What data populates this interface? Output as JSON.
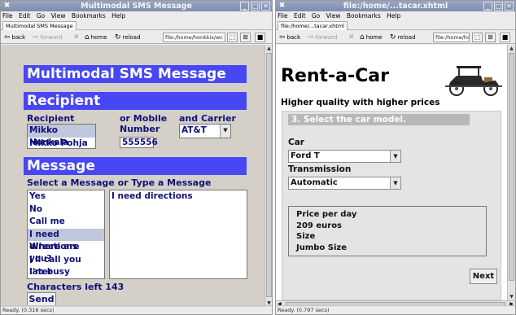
{
  "windows": [
    {
      "title": "Multimodal SMS Message",
      "menu": [
        "File",
        "Edit",
        "Go",
        "View",
        "Bookmarks",
        "Help"
      ],
      "tab": "Multimodal SMS Message",
      "toolbar": {
        "back": "back",
        "forward": "forward",
        "home": "home",
        "reload": "reload",
        "url": "file:/home/honkkis/wc"
      },
      "status": "Ready. (0.316 secs)",
      "page": {
        "heading": "Multimodal SMS Message",
        "recipient_section": "Recipient",
        "col_recipient": "Recipient",
        "col_mobile": "or Mobile",
        "col_number": "Number",
        "col_carrier": "and Carrier",
        "recipients": [
          "Mikko Honkala",
          "Mikko Pohja"
        ],
        "number": "555556",
        "carrier": "AT&T",
        "message_section": "Message",
        "select_prompt": "Select a Message or Type a Message",
        "messages": [
          "Yes",
          "No",
          "Call me",
          "I need directions",
          "Where are you?",
          "I'll call you later",
          "I'm busy"
        ],
        "message_text": "I need directions",
        "chars_left": "Characters left 143",
        "send": "Send"
      }
    },
    {
      "title": "file:/home/...tacar.xhtml",
      "menu": [
        "File",
        "Edit",
        "Go",
        "View",
        "Bookmarks",
        "Help"
      ],
      "tab": "file:/home/...tacar.xhtml",
      "toolbar": {
        "back": "back",
        "forward": "forward",
        "home": "home",
        "reload": "reload",
        "url": "file:/home/ho"
      },
      "status": "Ready. (0.797 secs)",
      "page": {
        "heading": "Rent-a-Car",
        "tagline": "Higher quality with higher prices",
        "step": "3. Select the car model.",
        "car_label": "Car",
        "car_value": "Ford T",
        "trans_label": "Transmission",
        "trans_value": "Automatic",
        "info": [
          "Price per day",
          "209 euros",
          "Size",
          "Jumbo Size"
        ],
        "next": "Next"
      }
    }
  ],
  "colors": {
    "section_bar": "#4747f5",
    "form_bg": "#d4d0c8",
    "text_navy": "#101078"
  }
}
